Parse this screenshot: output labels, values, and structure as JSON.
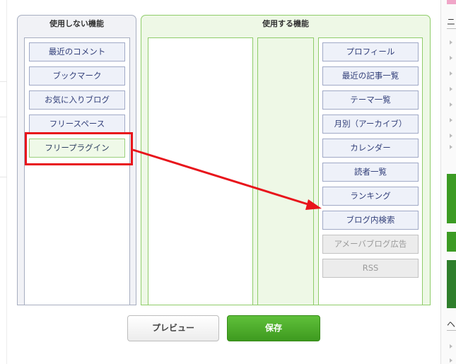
{
  "unused_panel": {
    "title": "使用しない機能",
    "items": [
      "最近のコメント",
      "ブックマーク",
      "お気に入りブログ",
      "フリースペース",
      "フリープラグイン"
    ]
  },
  "used_panel": {
    "title": "使用する機能",
    "items": [
      "プロフィール",
      "最近の記事一覧",
      "テーマ一覧",
      "月別（アーカイブ）",
      "カレンダー",
      "読者一覧",
      "ランキング",
      "ブログ内検索",
      "アメーバブログ広告",
      "RSS"
    ]
  },
  "buttons": {
    "preview_label": "プレビュー",
    "save_label": "保存"
  },
  "right_sidebar": {
    "header_char_1": "ニ",
    "header_char_2": "ヘ"
  },
  "colors": {
    "highlight": "#e8141b",
    "save_button": "#4caf2b",
    "used_panel_border": "#8fcc6a"
  }
}
